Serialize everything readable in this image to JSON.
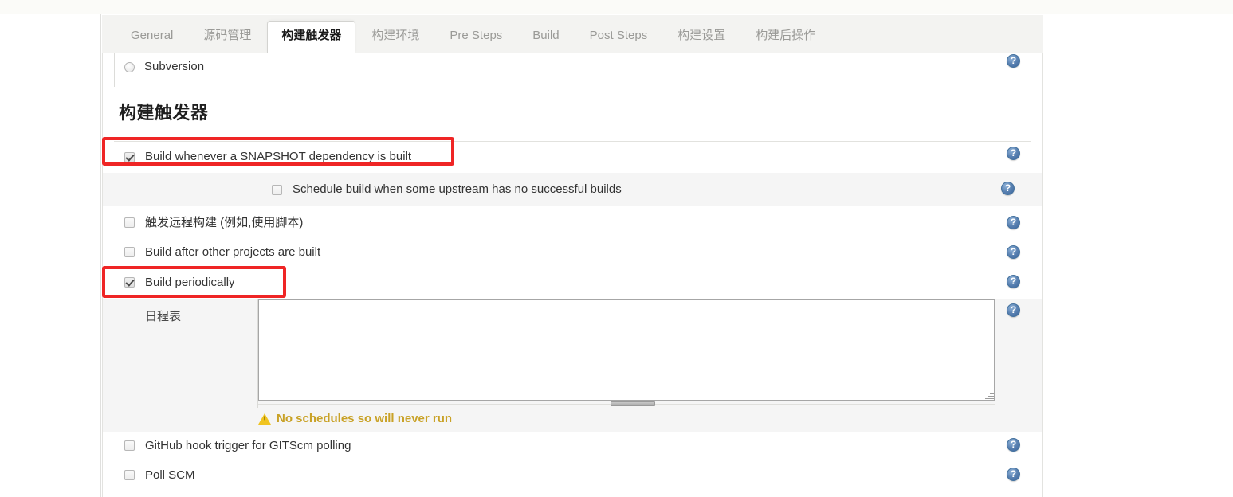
{
  "tabs": [
    {
      "label": "General",
      "active": false
    },
    {
      "label": "源码管理",
      "active": false
    },
    {
      "label": "构建触发器",
      "active": true
    },
    {
      "label": "构建环境",
      "active": false
    },
    {
      "label": "Pre Steps",
      "active": false
    },
    {
      "label": "Build",
      "active": false
    },
    {
      "label": "Post Steps",
      "active": false
    },
    {
      "label": "构建设置",
      "active": false
    },
    {
      "label": "构建后操作",
      "active": false
    }
  ],
  "scm": {
    "option_label": "Subversion",
    "checked": false,
    "help_icon": "help-icon"
  },
  "section": {
    "title": "构建触发器"
  },
  "triggers": [
    {
      "id": "snapshot-dependency",
      "label": "Build whenever a SNAPSHOT dependency is built",
      "checked": true,
      "highlighted": true,
      "help_icon": "help-icon"
    },
    {
      "id": "schedule-upstream",
      "label": "Schedule build when some upstream has no successful builds",
      "checked": false,
      "nested": true,
      "highlighted": false,
      "help_icon": "help-icon"
    },
    {
      "id": "remote-trigger",
      "label": "触发远程构建 (例如,使用脚本)",
      "checked": false,
      "highlighted": false,
      "help_icon": "help-icon"
    },
    {
      "id": "build-after-other",
      "label": "Build after other projects are built",
      "checked": false,
      "highlighted": false,
      "help_icon": "help-icon"
    },
    {
      "id": "build-periodically",
      "label": "Build periodically",
      "checked": true,
      "highlighted": true,
      "help_icon": "help-icon"
    },
    {
      "id": "github-hook",
      "label": "GitHub hook trigger for GITScm polling",
      "checked": false,
      "highlighted": false,
      "help_icon": "help-icon"
    },
    {
      "id": "poll-scm",
      "label": "Poll SCM",
      "checked": false,
      "highlighted": false,
      "help_icon": "help-icon"
    }
  ],
  "schedule": {
    "field_label": "日程表",
    "value": "",
    "placeholder": "",
    "warning_text": "No schedules so will never run",
    "warning_icon": "warning-triangle-icon",
    "help_icon": "help-icon"
  },
  "colors": {
    "annotation": "#ef2525",
    "warning": "#c9a227",
    "help_blue": "#3a649b",
    "row_shaded": "#f5f5f5"
  }
}
